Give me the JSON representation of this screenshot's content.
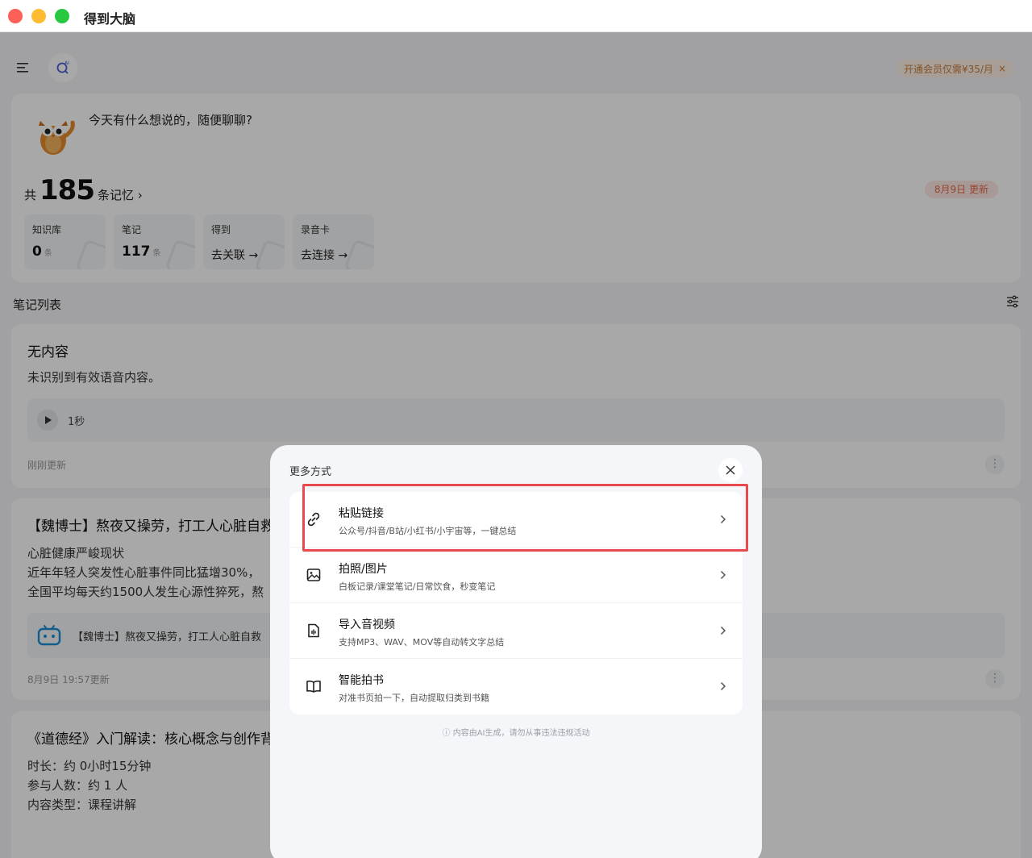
{
  "window": {
    "title": "得到大脑"
  },
  "header": {
    "promo": "开通会员仅需¥35/月",
    "promo_close": "×"
  },
  "hero": {
    "greeting": "今天有什么想说的，随便聊聊?",
    "memory_prefix": "共",
    "memory_count": "185",
    "memory_suffix": "条记忆 ›",
    "update_badge": "8月9日 更新",
    "stats": [
      {
        "label": "知识库",
        "value": "0",
        "unit": "条"
      },
      {
        "label": "笔记",
        "value": "117",
        "unit": "条"
      },
      {
        "label": "得到",
        "action": "去关联 →"
      },
      {
        "label": "录音卡",
        "action": "去连接 →"
      }
    ]
  },
  "notes": {
    "section_title": "笔记列表",
    "items": [
      {
        "title": "无内容",
        "body": [
          "未识别到有效语音内容。"
        ],
        "audio_duration": "1秒",
        "meta": "刚刚更新"
      },
      {
        "title": "【魏博士】熬夜又操劳，打工人心脏自救",
        "body": [
          "心脏健康严峻现状",
          "近年年轻人突发性心脏事件同比猛增30%，",
          "全国平均每天约1500人发生心源性猝死，熬"
        ],
        "link_text": "【魏博士】熬夜又操劳，打工人心脏自救",
        "meta": "8月9日 19:57更新"
      },
      {
        "title": "《道德经》入门解读：核心概念与创作背",
        "body": [
          "时长：约 0小时15分钟",
          "参与人数：约 1 人",
          "内容类型：课程讲解"
        ]
      }
    ]
  },
  "modal": {
    "title": "更多方式",
    "options": [
      {
        "title": "粘贴链接",
        "subtitle": "公众号/抖音/B站/小红书/小宇宙等，一键总结",
        "icon": "link-icon"
      },
      {
        "title": "拍照/图片",
        "subtitle": "白板记录/课堂笔记/日常饮食，秒变笔记",
        "icon": "image-icon"
      },
      {
        "title": "导入音视频",
        "subtitle": "支持MP3、WAV、MOV等自动转文字总结",
        "icon": "audio-file-icon"
      },
      {
        "title": "智能拍书",
        "subtitle": "对准书页拍一下，自动提取归类到书籍",
        "icon": "book-icon"
      }
    ],
    "disclaimer": "ⓘ 内容由AI生成，请勿从事违法违规活动"
  },
  "colors": {
    "highlight": "#e8494e",
    "accent_orange": "#e66a4c"
  }
}
